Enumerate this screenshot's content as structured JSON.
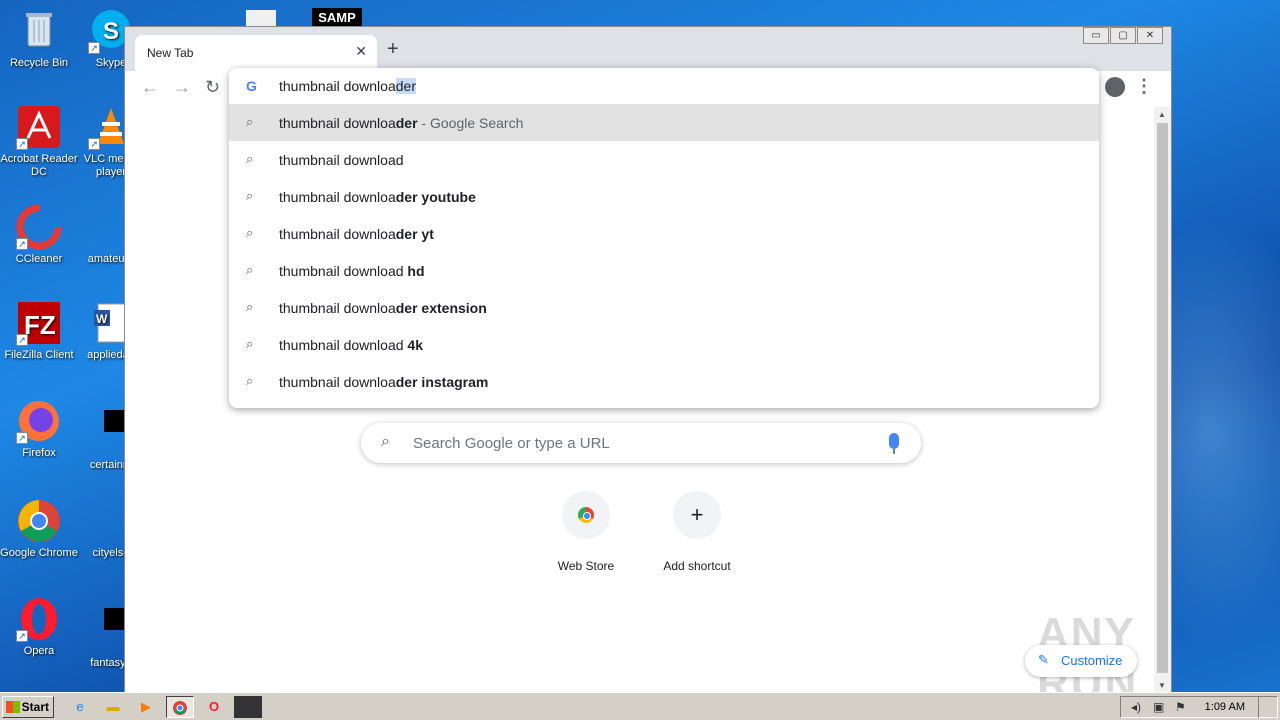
{
  "desktop": {
    "icons": [
      {
        "label": "Recycle Bin",
        "icon": "recycle-bin-icon"
      },
      {
        "label": "Skype",
        "icon": "skype-icon"
      },
      {
        "label": "Acrobat Reader DC",
        "icon": "acrobat-icon"
      },
      {
        "label": "VLC media player",
        "icon": "vlc-icon"
      },
      {
        "label": "CCleaner",
        "icon": "ccleaner-icon"
      },
      {
        "label": "amateurn",
        "icon": "blank-file-icon"
      },
      {
        "label": "FileZilla Client",
        "icon": "filezilla-icon"
      },
      {
        "label": "appliedag",
        "icon": "word-doc-icon"
      },
      {
        "label": "Firefox",
        "icon": "firefox-icon"
      },
      {
        "label": "certainm",
        "icon": "black-file-icon"
      },
      {
        "label": "Google Chrome",
        "icon": "chrome-icon"
      },
      {
        "label": "cityelse",
        "icon": "blank-file-icon"
      },
      {
        "label": "Opera",
        "icon": "opera-icon"
      },
      {
        "label": "fantasyu",
        "icon": "black-file-icon"
      }
    ],
    "top_partial_label": "SAMP"
  },
  "browser": {
    "tab_title": "New Tab",
    "tab_close": "✕",
    "new_tab": "+",
    "window_buttons": [
      "▭",
      "▢",
      "✕"
    ],
    "nav": {
      "back": "←",
      "forward": "→",
      "reload": "↻"
    },
    "menu": "⋮"
  },
  "omnibox": {
    "typed": "thumbnail downloa",
    "selected_completion": "der",
    "suggestions": [
      {
        "plain": "thumbnail downloa",
        "bold": "der",
        "suffix": " - Google Search",
        "highlighted": true
      },
      {
        "plain": "thumbnail download",
        "bold": "",
        "suffix": "",
        "highlighted": false
      },
      {
        "plain": "thumbnail downloa",
        "bold": "der youtube",
        "suffix": "",
        "highlighted": false
      },
      {
        "plain": "thumbnail downloa",
        "bold": "der yt",
        "suffix": "",
        "highlighted": false
      },
      {
        "plain": "thumbnail download ",
        "bold": "hd",
        "suffix": "",
        "highlighted": false
      },
      {
        "plain": "thumbnail downloa",
        "bold": "der extension",
        "suffix": "",
        "highlighted": false
      },
      {
        "plain": "thumbnail download ",
        "bold": "4k",
        "suffix": "",
        "highlighted": false
      },
      {
        "plain": "thumbnail downloa",
        "bold": "der instagram",
        "suffix": "",
        "highlighted": false
      }
    ]
  },
  "newtab": {
    "search_placeholder": "Search Google or type a URL",
    "shortcuts": [
      {
        "label": "Web Store",
        "icon": "chrome-web-store-icon"
      },
      {
        "label": "Add shortcut",
        "icon": "plus-icon",
        "glyph": "+"
      }
    ],
    "customize_label": "Customize",
    "watermark": "ANY RUN"
  },
  "taskbar": {
    "start_label": "Start",
    "clock": "1:09 AM",
    "apps": [
      "internet-explorer-icon",
      "folder-icon",
      "media-player-icon",
      "chrome-icon",
      "opera-icon",
      "app-icon"
    ]
  }
}
